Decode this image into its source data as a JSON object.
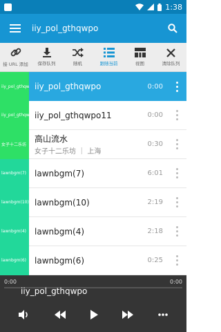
{
  "status": {
    "time": "1:38"
  },
  "app": {
    "title": "iiy_pol_gthqwpo"
  },
  "toolbar": [
    {
      "icon": "link-icon",
      "label": "接 URL 添加"
    },
    {
      "icon": "download-icon",
      "label": "保存队列"
    },
    {
      "icon": "shuffle-icon",
      "label": "随机"
    },
    {
      "icon": "list-icon",
      "label": "跟随当前"
    },
    {
      "icon": "grid-icon",
      "label": "视图"
    },
    {
      "icon": "close-icon",
      "label": "清除队列"
    }
  ],
  "playlist": [
    {
      "thumb": "iiy_pol_gthqwpo",
      "thumb_color": "#2ee066",
      "title": "iiy_pol_gthqwpo",
      "subtitle": "",
      "duration": "0:00",
      "selected": true
    },
    {
      "thumb": "iiy_pol_gthqwpo11",
      "thumb_color": "#2ee066",
      "title": "iiy_pol_gthqwpo11",
      "subtitle": "",
      "duration": "0:00",
      "selected": false
    },
    {
      "thumb": "女子十二乐坊",
      "thumb_color": "#2ee066",
      "title": "高山流水",
      "subtitle": "女子十二乐坊 ｜ 上海",
      "duration": "0:30",
      "selected": false
    },
    {
      "thumb": "lawnbgm(7)",
      "thumb_color": "#22d89a",
      "title": "lawnbgm(7)",
      "subtitle": "",
      "duration": "6:01",
      "selected": false
    },
    {
      "thumb": "lawnbgm(10)",
      "thumb_color": "#22d89a",
      "title": "lawnbgm(10)",
      "subtitle": "",
      "duration": "2:19",
      "selected": false
    },
    {
      "thumb": "lawnbgm(4)",
      "thumb_color": "#22d89a",
      "title": "lawnbgm(4)",
      "subtitle": "",
      "duration": "2:18",
      "selected": false
    },
    {
      "thumb": "lawnbgm(6)",
      "thumb_color": "#22d89a",
      "title": "lawnbgm(6)",
      "subtitle": "",
      "duration": "0:25",
      "selected": false
    }
  ],
  "player": {
    "current_time": "0:00",
    "total_time": "0:00",
    "title": "iiy_pol_gthqwpo",
    "progress": 0
  },
  "colors": {
    "primary": "#1795d3",
    "status_bar": "#0a7fb8",
    "selected_row": "#29a8e0",
    "toolbar_bg": "#ededed"
  }
}
